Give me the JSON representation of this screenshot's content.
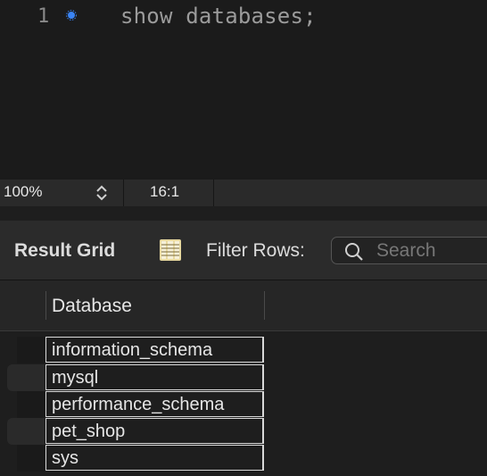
{
  "editor": {
    "line_number": "1",
    "code": "show databases;"
  },
  "statusbar": {
    "zoom": "100%",
    "cursor_position": "16:1"
  },
  "result_toolbar": {
    "title": "Result Grid",
    "filter_label": "Filter Rows:",
    "search_placeholder": "Search"
  },
  "grid": {
    "columns": [
      "Database"
    ],
    "rows": [
      "information_schema",
      "mysql",
      "performance_schema",
      "pet_shop",
      "sys"
    ]
  },
  "colors": {
    "breakpoint_dot": "#3a84f5",
    "editor_bg": "#1b1b1b",
    "cell_border": "#d9d9d9"
  },
  "icons": {
    "breakpoint": "breakpoint-dot-icon",
    "zoom_stepper": "chevron-updown-icon",
    "grid_toggle": "grid-columns-icon",
    "search": "search-icon"
  }
}
